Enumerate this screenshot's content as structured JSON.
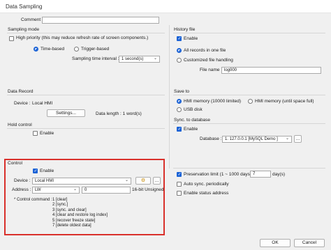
{
  "window": {
    "title": "Data Sampling"
  },
  "comment": {
    "label": "Comment :",
    "value": ""
  },
  "sampling_mode": {
    "label": "Sampling mode",
    "high_priority_label": "High priority (this may reduce refresh rate of screen components.)",
    "time_based_label": "Time-based",
    "trigger_based_label": "Trigger-based",
    "interval_label": "Sampling time interval :",
    "interval_value": "1 second(s)"
  },
  "data_record": {
    "label": "Data Record",
    "device_label": "Device :",
    "device_value": "Local HMI",
    "settings_button": "Settings...",
    "data_length": "Data length : 1 word(s)"
  },
  "hold_control": {
    "label": "Hold control",
    "enable_label": "Enable"
  },
  "control": {
    "label": "Control",
    "enable_label": "Enable",
    "device_label": "Device :",
    "device_value": "Local HMI",
    "address_label": "Address :",
    "address_type": "LW",
    "address_value": "0",
    "format": "16-bit Unsigned",
    "command_title": "* Control command :",
    "commands": [
      "1 [clear]",
      "2 [sync.]",
      "3 [sync. and clear]",
      "4 [clear and restore log index]",
      "5 [recover freeze state]",
      "7 [delete oldest data]"
    ]
  },
  "history_file": {
    "label": "History file",
    "enable_label": "Enable",
    "all_records_label": "All records in one file",
    "customized_label": "Customized file handling",
    "file_name_label": "File name :",
    "file_name_value": "log000"
  },
  "save_to": {
    "label": "Save to",
    "hmi_limited": "HMI memory (10000 limited)",
    "hmi_until_full": "HMI memory (until space full)",
    "usb_disk": "USB disk"
  },
  "sync_db": {
    "label": "Sync. to database",
    "enable_label": "Enable",
    "database_label": "Database :",
    "database_value": "1. 127.0.0.1 [MySQL Demo ]"
  },
  "options": {
    "preservation_label": "Preservation limit (1 ~ 1000 days)",
    "preservation_value": "7",
    "preservation_unit": "day(s)",
    "auto_sync_label": "Auto sync. periodically",
    "status_address_label": "Enable status address"
  },
  "footer": {
    "ok_button": "OK",
    "cancel_button": "Cancel"
  },
  "colors": {
    "accent": "#1c63d6",
    "highlight_box": "#d9302b"
  }
}
